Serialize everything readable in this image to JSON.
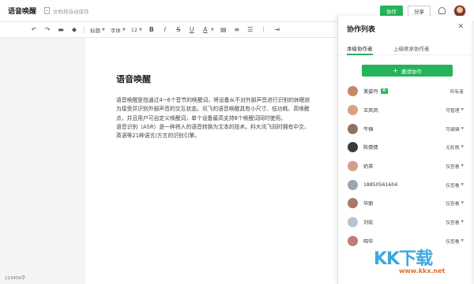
{
  "header": {
    "doc_title": "语音唤醒",
    "autosave_text": "文档将自动保存",
    "collab_button": "协作",
    "share_button": "分享"
  },
  "toolbar": {
    "undo_icon": "undo-icon",
    "redo_icon": "redo-icon",
    "heading_label": "标题",
    "font_label": "字体",
    "size_label": "12",
    "bold": "B",
    "italic": "I",
    "strike": "S",
    "underline": "U",
    "text_color": "A"
  },
  "document": {
    "heading": "语音唤醒",
    "paragraphs": [
      "语音唤醒是指通过4~6个音节的唤醒词，将设备从不对外部声音进行识别的休眠状",
      "为接受并识别外部声音的交互状态。讯飞的语音唤醒具有小尺寸、低功耗、高唤醒",
      "点，并且用户可自定义唤醒词，单个设备最高支持8个唤醒词同时使用。",
      "语音识别（ASR）是一种将人的语音转换为文本的技术。科大讯飞同时拥有中文、",
      "英语等21种语言/方言的识别引擎。"
    ]
  },
  "status": {
    "word_count": "123456字"
  },
  "panel": {
    "title": "协作列表",
    "tabs": [
      "本级协作者",
      "上级继承协作者"
    ],
    "invite_label": "邀请协作",
    "members": [
      {
        "name": "美姿丹",
        "badge": "我",
        "permission": "所有者",
        "has_chevron": false,
        "color": "#c9856a"
      },
      {
        "name": "王凤凤",
        "badge": "",
        "permission": "可管理",
        "has_chevron": true,
        "color": "#d9a184"
      },
      {
        "name": "牛頓",
        "badge": "",
        "permission": "可编辑",
        "has_chevron": true,
        "color": "#8a7362"
      },
      {
        "name": "陈倩倩",
        "badge": "",
        "permission": "无权限",
        "has_chevron": true,
        "color": "#3b3b3b"
      },
      {
        "name": "奶茶",
        "badge": "",
        "permission": "仅查看",
        "has_chevron": true,
        "color": "#d79b8e"
      },
      {
        "name": "18850561604",
        "badge": "",
        "permission": "仅查看",
        "has_chevron": true,
        "color": "#9aa7b3"
      },
      {
        "name": "华丽",
        "badge": "",
        "permission": "仅查看",
        "has_chevron": true,
        "color": "#a8796b"
      },
      {
        "name": "刘宏",
        "badge": "",
        "permission": "仅查看",
        "has_chevron": true,
        "color": "#b9c4d1"
      },
      {
        "name": "昭华",
        "badge": "",
        "permission": "仅查看",
        "has_chevron": true,
        "color": "#c07c76"
      }
    ]
  },
  "watermark": {
    "main": "KK下载",
    "url": "www.kkx.net"
  },
  "colors": {
    "accent": "#26b35a"
  }
}
